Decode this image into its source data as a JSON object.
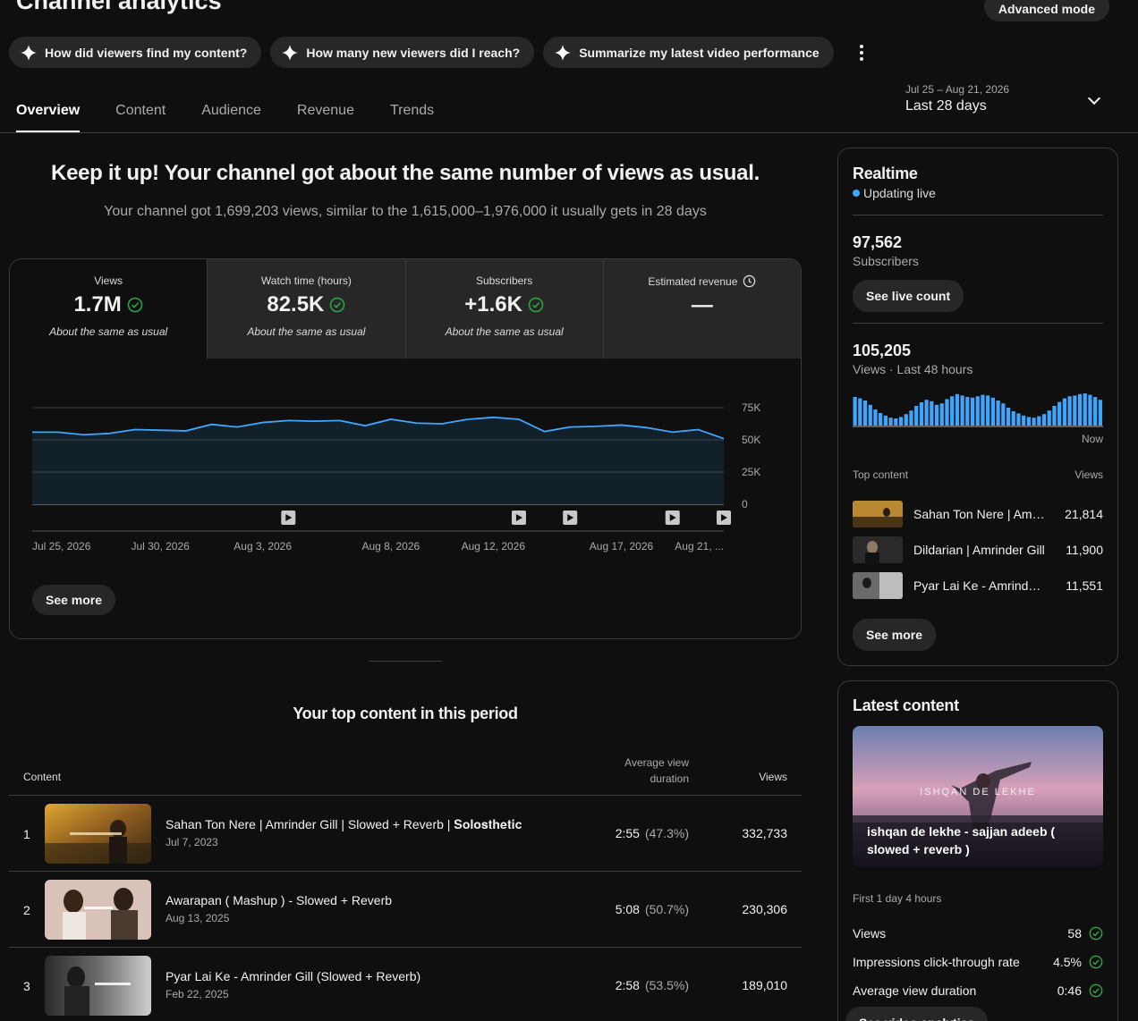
{
  "header": {
    "title": "Channel analytics",
    "advanced_mode": "Advanced mode"
  },
  "chips": [
    {
      "label": "How did viewers find my content?"
    },
    {
      "label": "How many new viewers did I reach?"
    },
    {
      "label": "Summarize my latest video performance"
    }
  ],
  "tabs": [
    "Overview",
    "Content",
    "Audience",
    "Revenue",
    "Trends"
  ],
  "active_tab": "Overview",
  "date_range": {
    "dates": "Jul 25 – Aug 21, 2026",
    "label": "Last 28 days"
  },
  "summary": {
    "headline": "Keep it up! Your channel got about the same number of views as usual.",
    "subline": "Your channel got 1,699,203 views, similar to the 1,615,000–1,976,000 it usually gets in 28 days"
  },
  "metrics": [
    {
      "label": "Views",
      "value": "1.7M",
      "note": "About the same as usual"
    },
    {
      "label": "Watch time (hours)",
      "value": "82.5K",
      "note": "About the same as usual"
    },
    {
      "label": "Subscribers",
      "value": "+1.6K",
      "note": "About the same as usual"
    },
    {
      "label": "Estimated revenue",
      "value": "—",
      "note": ""
    }
  ],
  "chart_data": {
    "type": "line",
    "ylim": [
      0,
      75000
    ],
    "yticks": [
      "75K",
      "50K",
      "25K",
      "0"
    ],
    "xtick_labels": [
      "Jul 25, 2026",
      "Jul 30, 2026",
      "Aug 3, 2026",
      "Aug 8, 2026",
      "Aug 12, 2026",
      "Aug 17, 2026",
      "Aug 21, ..."
    ],
    "series": [
      {
        "values": [
          56000,
          56000,
          54000,
          55000,
          58000,
          57500,
          57000,
          62000,
          60000,
          63500,
          65000,
          64500,
          65000,
          61000,
          66000,
          63000,
          62500,
          66000,
          67500,
          66000,
          56500,
          60000,
          60500,
          61500,
          59500,
          56000,
          58000,
          51000
        ]
      }
    ],
    "video_markers": [
      "Aug 4, 2026",
      "Aug 13, 2026",
      "Aug 15, 2026",
      "Aug 19, 2026",
      "Aug 21, 2026"
    ]
  },
  "see_more": "See more",
  "top_content": {
    "title": "Your top content in this period",
    "col_content": "Content",
    "col_avd": "Average view duration",
    "col_views": "Views",
    "rows": [
      {
        "rank": "1",
        "title": "Sahan Ton Nere | Amrinder Gill | Slowed + Reverb | 𝐒𝐨𝐥𝐨𝐬𝐭𝐡𝐞𝐭𝐢𝐜",
        "date": "Jul 7, 2023",
        "avd": "2:55",
        "pct": "(47.3%)",
        "views": "332,733"
      },
      {
        "rank": "2",
        "title": "Awarapan ( Mashup ) - Slowed + Reverb",
        "date": "Aug 13, 2025",
        "avd": "5:08",
        "pct": "(50.7%)",
        "views": "230,306"
      },
      {
        "rank": "3",
        "title": "Pyar Lai Ke - Amrinder Gill (Slowed + Reverb)",
        "date": "Feb 22, 2025",
        "avd": "2:58",
        "pct": "(53.5%)",
        "views": "189,010"
      }
    ]
  },
  "realtime": {
    "title": "Realtime",
    "status": "Updating live",
    "subscribers": "97,562",
    "subscribers_label": "Subscribers",
    "live_count": "See live count",
    "views": "105,205",
    "views_label": "Views · Last 48 hours",
    "now_label": "Now",
    "hourly_bars": [
      80,
      76,
      70,
      58,
      45,
      35,
      28,
      22,
      20,
      24,
      32,
      42,
      55,
      65,
      72,
      68,
      58,
      62,
      74,
      82,
      88,
      84,
      80,
      78,
      82,
      86,
      84,
      78,
      70,
      62,
      50,
      40,
      34,
      28,
      24,
      22,
      26,
      32,
      42,
      55,
      66,
      76,
      82,
      84,
      88,
      90,
      86,
      80,
      72
    ],
    "top_content_label": "Top content",
    "views_col": "Views",
    "items": [
      {
        "title": "Sahan Ton Nere | Amrinder Gill",
        "views": "21,814"
      },
      {
        "title": "Dildarian | Amrinder Gill",
        "views": "11,900"
      },
      {
        "title": "Pyar Lai Ke - Amrinder Gill",
        "views": "11,551"
      }
    ]
  },
  "latest": {
    "title": "Latest content",
    "video_title": "ishqan de lekhe - sajjan adeeb ( slowed + reverb )",
    "thumb_text": "ISHQAN DE LEKHE",
    "age": "First 1 day 4 hours",
    "stats": [
      {
        "label": "Views",
        "value": "58"
      },
      {
        "label": "Impressions click-through rate",
        "value": "4.5%"
      },
      {
        "label": "Average view duration",
        "value": "0:46"
      }
    ],
    "button": "See video analytics"
  },
  "colors": {
    "accent_blue": "#3ea6ff",
    "success_green": "#2ba640",
    "chart_fill": "#12202a"
  }
}
